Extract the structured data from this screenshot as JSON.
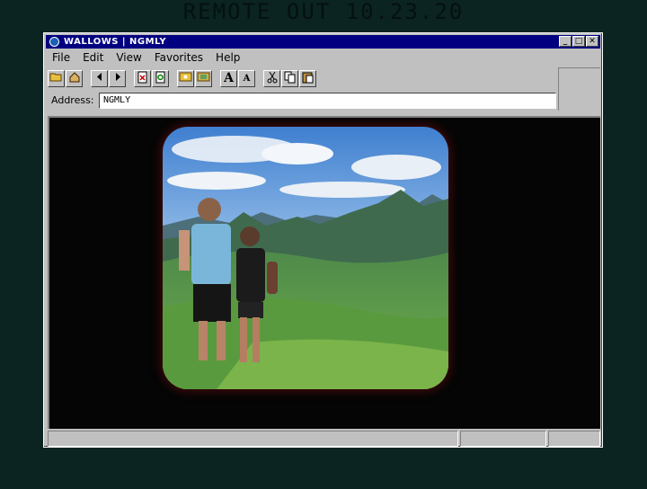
{
  "banner": "REMOTE OUT 10.23.20",
  "window": {
    "title": "WALLOWS | NGMLY",
    "buttons": {
      "minimize": "_",
      "maximize": "□",
      "close": "✕"
    }
  },
  "menu": [
    {
      "label": "File"
    },
    {
      "label": "Edit"
    },
    {
      "label": "View"
    },
    {
      "label": "Favorites"
    },
    {
      "label": "Help"
    }
  ],
  "toolbar": {
    "icons": [
      "open-folder-icon",
      "home-icon",
      "back-icon",
      "forward-icon",
      "stop-icon",
      "refresh-icon",
      "picture-icon",
      "pictures-icon",
      "increase-font-icon",
      "decrease-font-icon",
      "cut-icon",
      "copy-icon",
      "paste-icon"
    ]
  },
  "address": {
    "label": "Address:",
    "value": "NGMLY"
  },
  "colors": {
    "background": "#0b2421",
    "titlebar": "#000080",
    "chrome": "#c0c0c0"
  }
}
